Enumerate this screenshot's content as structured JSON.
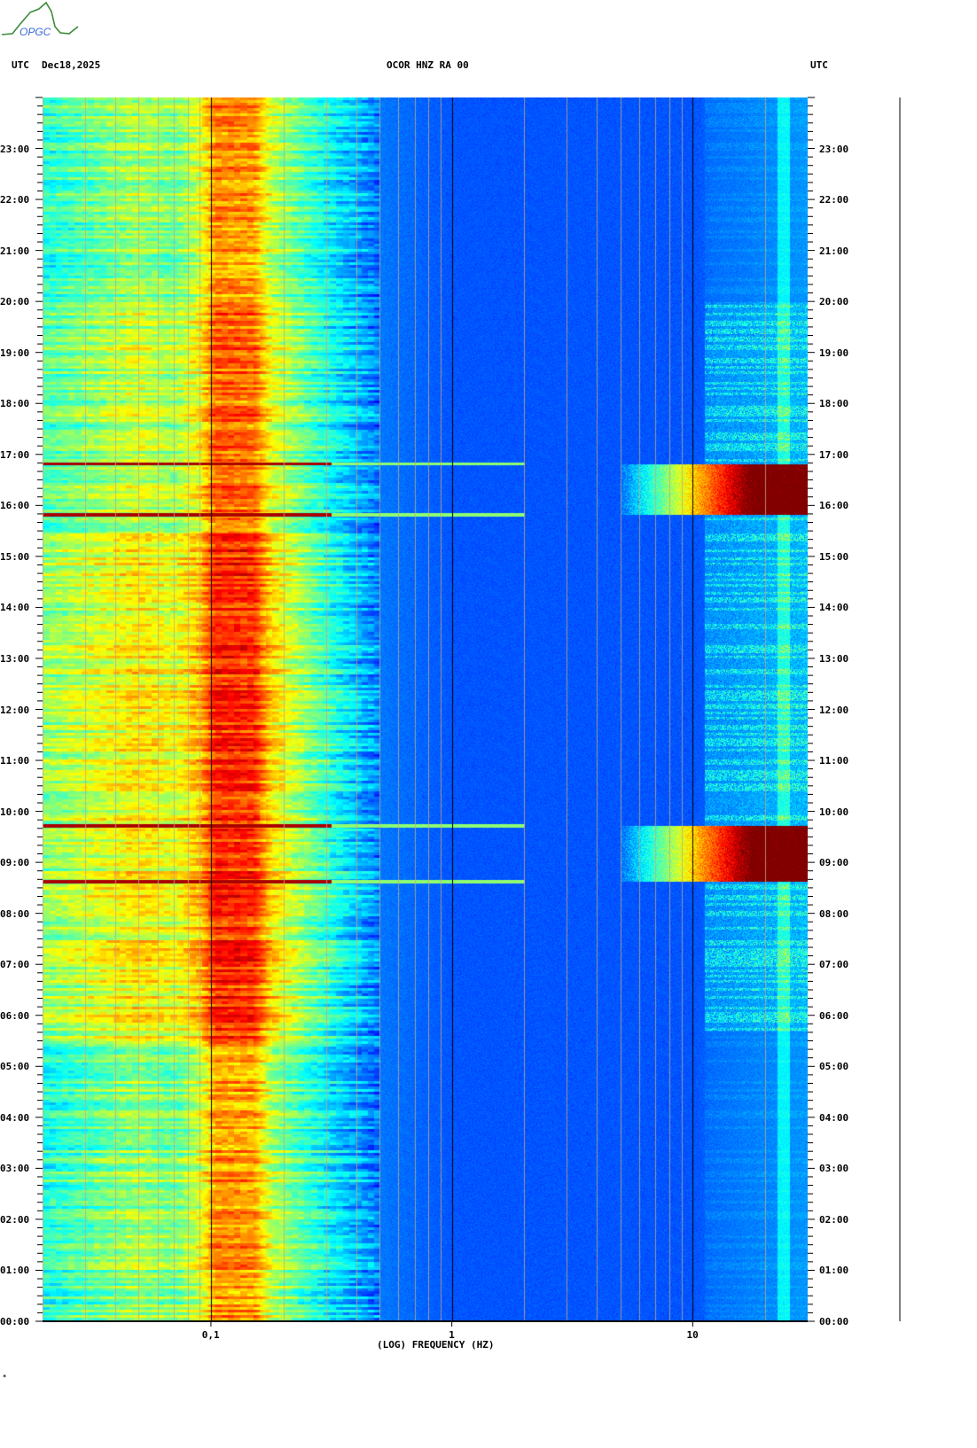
{
  "logo_text": "OPGC",
  "header": {
    "left_tz": "UTC",
    "date": "Dec18,2025",
    "station": "OCOR HNZ RA 00",
    "right_tz": "UTC"
  },
  "footer_mark": "*",
  "chart_data": {
    "type": "heatmap",
    "title": "OCOR HNZ RA 00",
    "xlabel": "(LOG) FREQUENCY (HZ)",
    "ylabel": "UTC",
    "xscale": "log",
    "xlim": [
      0.02,
      30
    ],
    "ylim_hours": [
      0,
      24
    ],
    "x_ticks": [
      {
        "value": 0.1,
        "label": "0,1"
      },
      {
        "value": 1,
        "label": "1"
      },
      {
        "value": 10,
        "label": "10"
      }
    ],
    "y_ticks": [
      "00:00",
      "01:00",
      "02:00",
      "03:00",
      "04:00",
      "05:00",
      "06:00",
      "07:00",
      "08:00",
      "09:00",
      "10:00",
      "11:00",
      "12:00",
      "13:00",
      "14:00",
      "15:00",
      "16:00",
      "17:00",
      "18:00",
      "19:00",
      "20:00",
      "21:00",
      "22:00",
      "23:00"
    ],
    "colormap": "jet",
    "features": {
      "microseism_band_hz": [
        0.1,
        0.16
      ],
      "broadband_events": [
        {
          "start_h": 15.82,
          "end_h": 16.82,
          "min_freq_hz": 5
        },
        {
          "start_h": 8.63,
          "end_h": 9.72,
          "min_freq_hz": 5
        }
      ],
      "horizontal_lines_h": [
        16.82,
        15.82,
        8.63,
        9.72
      ],
      "daytime_activity_h": [
        5.5,
        20
      ]
    }
  }
}
